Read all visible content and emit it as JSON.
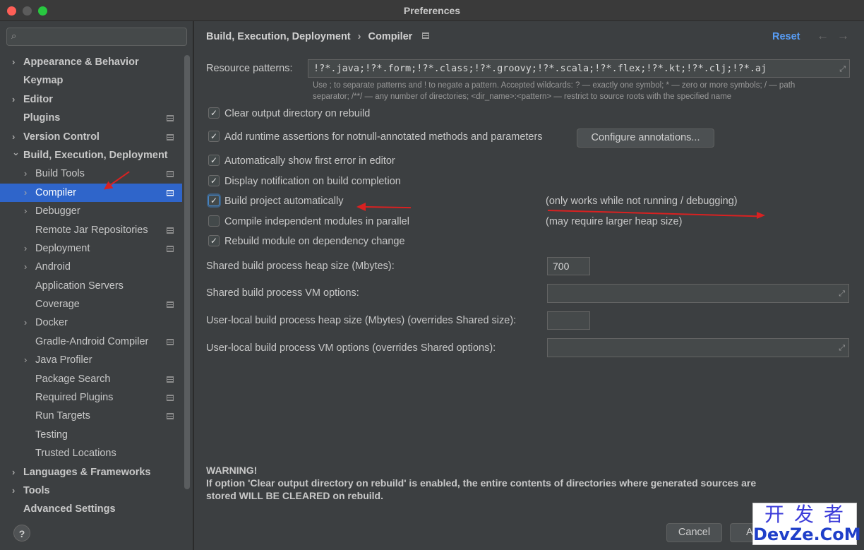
{
  "window": {
    "title": "Preferences"
  },
  "search": {
    "placeholder": ""
  },
  "sidebar": {
    "items": [
      {
        "label": "Appearance & Behavior",
        "level": 0,
        "chevron": true,
        "bold": true,
        "project": false,
        "selected": false
      },
      {
        "label": "Keymap",
        "level": 0,
        "chevron": false,
        "bold": true,
        "project": false,
        "selected": false
      },
      {
        "label": "Editor",
        "level": 0,
        "chevron": true,
        "bold": true,
        "project": false,
        "selected": false
      },
      {
        "label": "Plugins",
        "level": 0,
        "chevron": false,
        "bold": true,
        "project": true,
        "selected": false
      },
      {
        "label": "Version Control",
        "level": 0,
        "chevron": true,
        "bold": true,
        "project": true,
        "selected": false
      },
      {
        "label": "Build, Execution, Deployment",
        "level": 0,
        "chevron": true,
        "expanded": true,
        "bold": true,
        "project": false,
        "selected": false
      },
      {
        "label": "Build Tools",
        "level": 1,
        "chevron": true,
        "bold": false,
        "project": true,
        "selected": false
      },
      {
        "label": "Compiler",
        "level": 1,
        "chevron": true,
        "bold": false,
        "project": true,
        "selected": true
      },
      {
        "label": "Debugger",
        "level": 1,
        "chevron": true,
        "bold": false,
        "project": false,
        "selected": false
      },
      {
        "label": "Remote Jar Repositories",
        "level": 1,
        "chevron": false,
        "bold": false,
        "project": true,
        "selected": false
      },
      {
        "label": "Deployment",
        "level": 1,
        "chevron": true,
        "bold": false,
        "project": true,
        "selected": false
      },
      {
        "label": "Android",
        "level": 1,
        "chevron": true,
        "bold": false,
        "project": false,
        "selected": false
      },
      {
        "label": "Application Servers",
        "level": 1,
        "chevron": false,
        "bold": false,
        "project": false,
        "selected": false
      },
      {
        "label": "Coverage",
        "level": 1,
        "chevron": false,
        "bold": false,
        "project": true,
        "selected": false
      },
      {
        "label": "Docker",
        "level": 1,
        "chevron": true,
        "bold": false,
        "project": false,
        "selected": false
      },
      {
        "label": "Gradle-Android Compiler",
        "level": 1,
        "chevron": false,
        "bold": false,
        "project": true,
        "selected": false
      },
      {
        "label": "Java Profiler",
        "level": 1,
        "chevron": true,
        "bold": false,
        "project": false,
        "selected": false
      },
      {
        "label": "Package Search",
        "level": 1,
        "chevron": false,
        "bold": false,
        "project": true,
        "selected": false
      },
      {
        "label": "Required Plugins",
        "level": 1,
        "chevron": false,
        "bold": false,
        "project": true,
        "selected": false
      },
      {
        "label": "Run Targets",
        "level": 1,
        "chevron": false,
        "bold": false,
        "project": true,
        "selected": false
      },
      {
        "label": "Testing",
        "level": 1,
        "chevron": false,
        "bold": false,
        "project": false,
        "selected": false
      },
      {
        "label": "Trusted Locations",
        "level": 1,
        "chevron": false,
        "bold": false,
        "project": false,
        "selected": false
      },
      {
        "label": "Languages & Frameworks",
        "level": 0,
        "chevron": true,
        "bold": true,
        "project": false,
        "selected": false
      },
      {
        "label": "Tools",
        "level": 0,
        "chevron": true,
        "bold": true,
        "project": false,
        "selected": false
      },
      {
        "label": "Advanced Settings",
        "level": 0,
        "chevron": false,
        "bold": true,
        "project": false,
        "selected": false
      }
    ]
  },
  "header": {
    "crumb_parent": "Build, Execution, Deployment",
    "crumb_separator": "›",
    "crumb_current": "Compiler",
    "reset_label": "Reset",
    "back_icon": "arrow-left-icon",
    "forward_icon": "arrow-right-icon"
  },
  "resource": {
    "label": "Resource patterns:",
    "value": "!?*.java;!?*.form;!?*.class;!?*.groovy;!?*.scala;!?*.flex;!?*.kt;!?*.clj;!?*.aj",
    "hint_line1": "Use ; to separate patterns and ! to negate a pattern. Accepted wildcards: ? — exactly one symbol; * — zero or more symbols; / — path",
    "hint_line2": "separator; /**/ — any number of directories; <dir_name>:<pattern> — restrict to source roots with the specified name"
  },
  "options": {
    "clear_output": {
      "label": "Clear output directory on rebuild",
      "checked": true
    },
    "runtime_assertions": {
      "label": "Add runtime assertions for notnull-annotated methods and parameters",
      "checked": true
    },
    "configure_annotations": "Configure annotations...",
    "show_first_error": {
      "label": "Automatically show first error in editor",
      "checked": true
    },
    "notify_completion": {
      "label": "Display notification on build completion",
      "checked": true
    },
    "build_auto": {
      "label": "Build project automatically",
      "checked": true,
      "note": "(only works while not running / debugging)"
    },
    "compile_parallel": {
      "label": "Compile independent modules in parallel",
      "checked": false,
      "note": "(may require larger heap size)"
    },
    "rebuild_on_dep": {
      "label": "Rebuild module on dependency change",
      "checked": true
    }
  },
  "fields": {
    "shared_heap": {
      "label": "Shared build process heap size (Mbytes):",
      "value": "700"
    },
    "shared_vm": {
      "label": "Shared build process VM options:",
      "value": ""
    },
    "user_heap": {
      "label": "User-local build process heap size (Mbytes) (overrides Shared size):",
      "value": ""
    },
    "user_vm": {
      "label": "User-local build process VM options (overrides Shared options):",
      "value": ""
    }
  },
  "warning": {
    "title": "WARNING!",
    "line1": "If option 'Clear output directory on rebuild' is enabled, the entire contents of directories where generated sources are",
    "line2": "stored WILL BE CLEARED on rebuild."
  },
  "footer": {
    "cancel_label": "Cancel",
    "apply_label": "A",
    "help_label": "?"
  },
  "watermark": {
    "top": "开发者",
    "bottom": "DevZe.CoM"
  },
  "colors": {
    "selection": "#2f65ca",
    "link": "#589df6",
    "annotation": "#d92121"
  }
}
